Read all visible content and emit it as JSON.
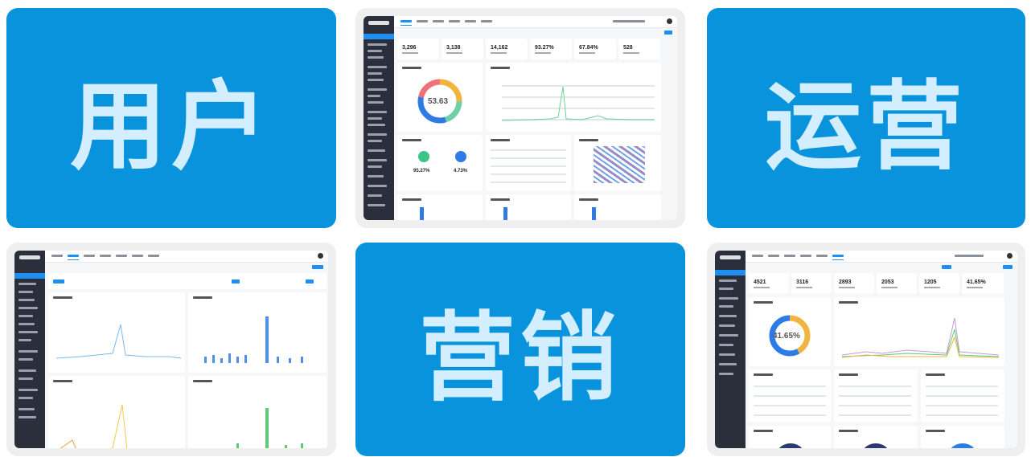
{
  "tiles": {
    "user": {
      "label": "用户"
    },
    "ops": {
      "label": "运营"
    },
    "marketing": {
      "label": "营销"
    }
  },
  "dash1": {
    "kpis": [
      "3,296",
      "3,138",
      "14,162",
      "93.27%",
      "67.84%",
      "528"
    ],
    "donut_value": "53.63",
    "circle_left_value": "95.27%",
    "circle_right_value": "4.73%"
  },
  "dash3": {
    "kpis": [
      "4521",
      "3116",
      "2893",
      "2053",
      "1205",
      "41.65%"
    ],
    "donut_value": "41.65%"
  },
  "colors": {
    "tile_blue": "#0a93dd",
    "tile_text": "#d3efff",
    "accent": "#1f8ef1",
    "sidebar": "#2b2f3c"
  }
}
